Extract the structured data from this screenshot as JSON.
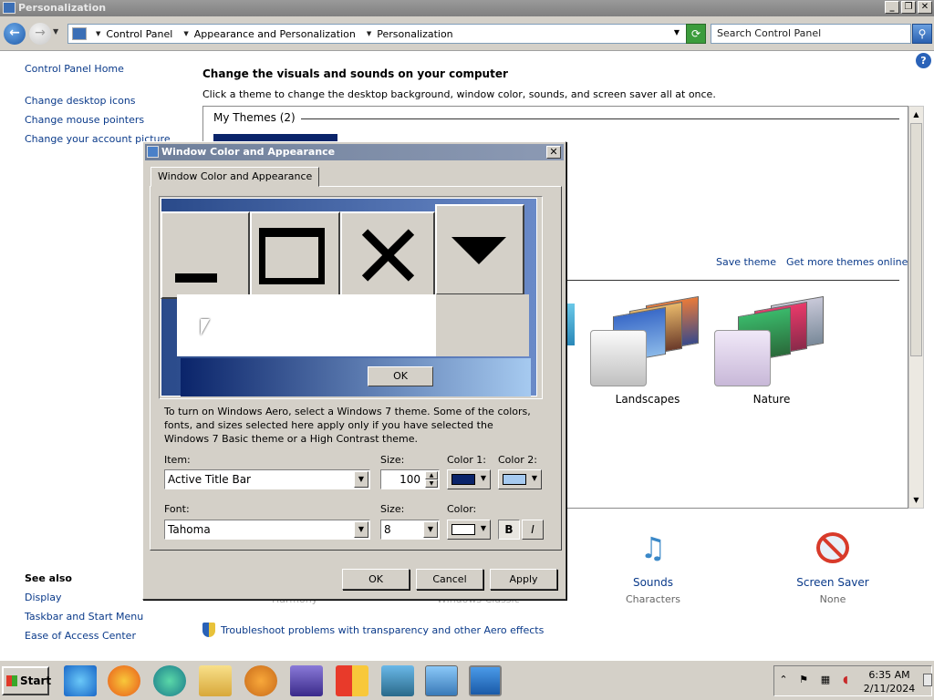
{
  "window": {
    "title": "Personalization",
    "min": "_",
    "restore": "❐",
    "close": "✕"
  },
  "nav": {
    "back": "←",
    "forward": "→",
    "breadcrumbs": [
      "Control Panel",
      "Appearance and Personalization",
      "Personalization"
    ],
    "search_placeholder": "Search Control Panel"
  },
  "sidebar": {
    "home": "Control Panel Home",
    "links": [
      "Change desktop icons",
      "Change mouse pointers",
      "Change your account picture"
    ],
    "see_also_title": "See also",
    "see_also": [
      "Display",
      "Taskbar and Start Menu",
      "Ease of Access Center"
    ]
  },
  "main": {
    "heading": "Change the visuals and sounds on your computer",
    "subheading": "Click a theme to change the desktop background, window color, sounds, and screen saver all at once.",
    "my_themes": "My Themes (2)",
    "save_theme": "Save theme",
    "get_more": "Get more themes online",
    "themes": [
      "Landscapes",
      "Nature"
    ],
    "bottom": [
      {
        "name": "Sounds",
        "sub": "Characters"
      },
      {
        "name": "Screen Saver",
        "sub": "None"
      }
    ],
    "bottom_partial": [
      "Harmony",
      "Windows Classic"
    ],
    "troubleshoot": "Troubleshoot problems with transparency and other Aero effects"
  },
  "dialog": {
    "title": "Window Color and Appearance",
    "tab": "Window Color and Appearance",
    "preview_ok": "OK",
    "note": "To turn on Windows Aero, select a Windows 7 theme.  Some of the colors, fonts, and sizes selected here apply only if you have selected the Windows 7 Basic theme or a High Contrast theme.",
    "item_label": "Item:",
    "item_value": "Active Title Bar",
    "size_label": "Size:",
    "size_value": "100",
    "color1_label": "Color 1:",
    "color2_label": "Color 2:",
    "color1": "#0a246a",
    "color2": "#a6caf0",
    "font_label": "Font:",
    "font_value": "Tahoma",
    "font_size_label": "Size:",
    "font_size_value": "8",
    "font_color_label": "Color:",
    "font_color": "#ffffff",
    "bold": "B",
    "italic": "I",
    "ok": "OK",
    "cancel": "Cancel",
    "apply": "Apply"
  },
  "taskbar": {
    "start": "Start",
    "apps": [
      "internet-explorer-icon",
      "firefox-icon",
      "edge-icon",
      "file-explorer-icon",
      "media-player-icon",
      "visual-studio-icon",
      "office-icon",
      "network-icon",
      "remote-desktop-icon",
      "personalization-icon"
    ],
    "time": "6:35 AM",
    "date": "2/11/2024"
  }
}
